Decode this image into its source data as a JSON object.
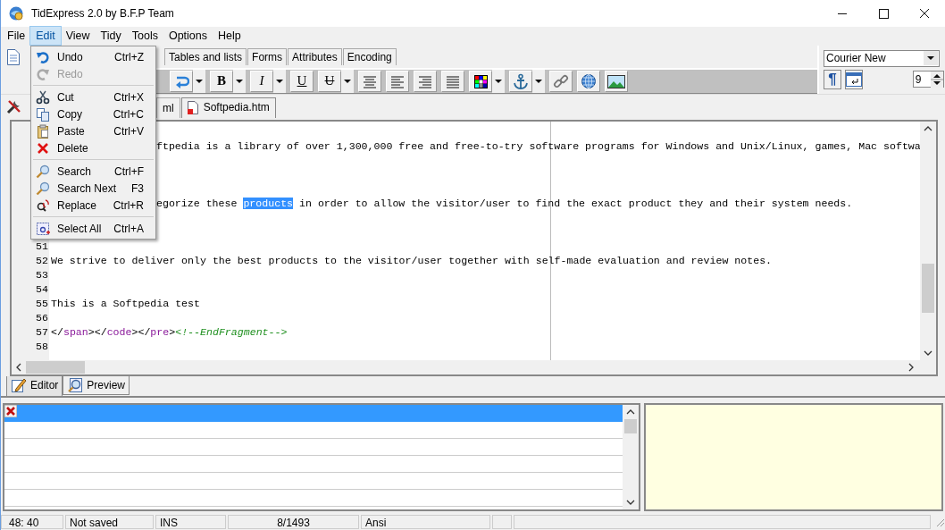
{
  "window": {
    "title": "TidExpress 2.0 by B.F.P Team"
  },
  "menu_bar": [
    {
      "label": "File",
      "selected": false
    },
    {
      "label": "Edit",
      "selected": true
    },
    {
      "label": "View",
      "selected": false
    },
    {
      "label": "Tidy",
      "selected": false
    },
    {
      "label": "Tools",
      "selected": false
    },
    {
      "label": "Options",
      "selected": false
    },
    {
      "label": "Help",
      "selected": false
    }
  ],
  "edit_menu": [
    {
      "kind": "item",
      "label": "Undo",
      "shortcut": "Ctrl+Z",
      "disabled": false
    },
    {
      "kind": "item",
      "label": "Redo",
      "disabled": true
    },
    {
      "kind": "separator"
    },
    {
      "kind": "item",
      "label": "Cut",
      "shortcut": "Ctrl+X",
      "disabled": false
    },
    {
      "kind": "item",
      "label": "Copy",
      "shortcut": "Ctrl+C",
      "disabled": false
    },
    {
      "kind": "item",
      "label": "Paste",
      "shortcut": "Ctrl+V",
      "disabled": false
    },
    {
      "kind": "item",
      "label": "Delete",
      "disabled": false
    },
    {
      "kind": "separator"
    },
    {
      "kind": "item",
      "label": "Search",
      "shortcut": "Ctrl+F",
      "disabled": false
    },
    {
      "kind": "item",
      "label": "Search Next",
      "shortcut": "F3",
      "disabled": false
    },
    {
      "kind": "item",
      "label": "Replace",
      "shortcut": "Ctrl+R",
      "disabled": false
    },
    {
      "kind": "separator"
    },
    {
      "kind": "item",
      "label": "Select All",
      "shortcut": "Ctrl+A",
      "disabled": false
    }
  ],
  "toolbar_tabs": [
    {
      "label": "Tables and lists",
      "selected": false
    },
    {
      "label": "Forms",
      "selected": false
    },
    {
      "label": "Attributes",
      "selected": false
    },
    {
      "label": "Encoding",
      "selected": false
    }
  ],
  "format_toolbar": [
    {
      "kind": "wrap",
      "dropdown": true
    },
    {
      "kind": "bold",
      "label": "B",
      "dropdown": true
    },
    {
      "kind": "italic",
      "label": "I",
      "dropdown": true
    },
    {
      "kind": "underline",
      "label": "U",
      "dropdown": false
    },
    {
      "kind": "strike",
      "label": "U",
      "dropdown": true
    },
    {
      "kind": "center",
      "dropdown": false
    },
    {
      "kind": "left",
      "dropdown": false
    },
    {
      "kind": "right",
      "dropdown": false
    },
    {
      "kind": "justify",
      "dropdown": false
    },
    {
      "kind": "colors",
      "dropdown": true
    },
    {
      "kind": "anchor",
      "dropdown": true
    },
    {
      "kind": "link",
      "dropdown": false
    },
    {
      "kind": "globe",
      "dropdown": false
    },
    {
      "kind": "image",
      "dropdown": false
    }
  ],
  "font_panel": {
    "font": "Courier New",
    "paragraph_button": "¶",
    "size": "9"
  },
  "document_tabs": [
    {
      "label": "ml",
      "selected": false
    },
    {
      "label": "Softpedia.htm",
      "selected": true
    }
  ],
  "editor": {
    "lines": [
      {
        "covered": true,
        "segments": [
          {
            "kind": "text",
            "text": "ftpedia is a library of over 1,300,000 free and free-to-try software programs for Windows and Unix/Linux, games, Mac softwa"
          }
        ]
      },
      {
        "covered": true,
        "segments": [
          {
            "kind": "text",
            "text": "egorize these "
          },
          {
            "kind": "text",
            "text": "products",
            "selected": true
          },
          {
            "kind": "text",
            "text": " in order to allow the visitor/user to find the exact product they and their system needs."
          }
        ]
      },
      {
        "number": "51"
      },
      {
        "number": "52",
        "segments": [
          {
            "kind": "text",
            "text": "We strive to deliver only the best products to the visitor/user together with self-made evaluation and review notes."
          }
        ]
      },
      {
        "number": "53"
      },
      {
        "number": "54"
      },
      {
        "number": "55",
        "segments": [
          {
            "kind": "text",
            "text": "This is a Softpedia test"
          }
        ]
      },
      {
        "number": "56"
      },
      {
        "number": "57",
        "segments": [
          {
            "kind": "text",
            "text": "</"
          },
          {
            "kind": "tag",
            "text": "span"
          },
          {
            "kind": "text",
            "text": "></"
          },
          {
            "kind": "tag",
            "text": "code"
          },
          {
            "kind": "text",
            "text": "></"
          },
          {
            "kind": "tag",
            "text": "pre"
          },
          {
            "kind": "text",
            "text": ">"
          },
          {
            "kind": "comment",
            "text": "<!--EndFragment-->"
          }
        ]
      },
      {
        "number": "58"
      }
    ]
  },
  "view_tabs": [
    {
      "label": "Editor",
      "selected": true
    },
    {
      "label": "Preview",
      "selected": false
    }
  ],
  "messages": {
    "rows": [
      {
        "selected": true
      },
      {
        "selected": false
      },
      {
        "selected": false
      },
      {
        "selected": false
      },
      {
        "selected": false
      },
      {
        "selected": false
      }
    ]
  },
  "status_bar": [
    "48: 40",
    "Not saved",
    "INS",
    "8/1493",
    "Ansi"
  ]
}
